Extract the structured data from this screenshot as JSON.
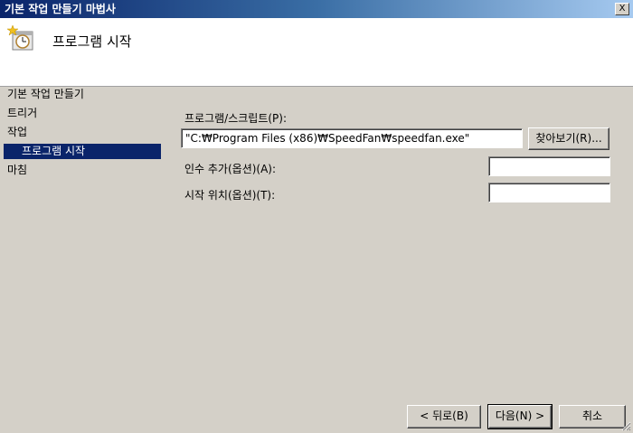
{
  "window": {
    "title": "기본 작업 만들기 마법사",
    "close_label": "X"
  },
  "header": {
    "title": "프로그램 시작",
    "icon": "scheduled-task-clock-icon"
  },
  "nav": {
    "items": [
      {
        "label": "기본 작업 만들기"
      },
      {
        "label": "트리거"
      },
      {
        "label": "작업"
      },
      {
        "label": "프로그램 시작",
        "selected": true
      },
      {
        "label": "마침"
      }
    ]
  },
  "form": {
    "program_label": "프로그램/스크립트(P):",
    "program_value": "\"C:₩Program Files (x86)₩SpeedFan₩speedfan.exe\"",
    "browse_label": "찾아보기(R)...",
    "args_label": "인수 추가(옵션)(A):",
    "args_value": "",
    "startin_label": "시작 위치(옵션)(T):",
    "startin_value": ""
  },
  "footer": {
    "back_label": "< 뒤로(B)",
    "next_label": "다음(N) >",
    "cancel_label": "취소"
  }
}
